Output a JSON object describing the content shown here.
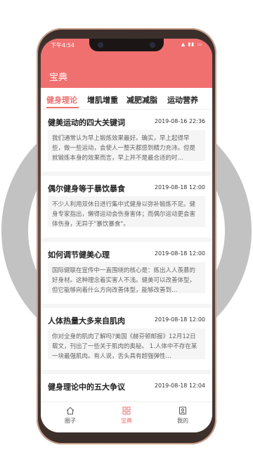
{
  "status_bar": {
    "time": "下午4:54",
    "icons": "▲ ▮▮ ▭"
  },
  "app": {
    "title": "宝典"
  },
  "tabs": [
    {
      "label": "健身理论"
    },
    {
      "label": "增肌增重"
    },
    {
      "label": "减肥减脂"
    },
    {
      "label": "运动营养"
    }
  ],
  "articles": [
    {
      "title": "健美运动的四大关键词",
      "date": "2019-08-16 22:36",
      "summary": "我们通常认为早上锻炼效果最好。确实，早上起得早些，做一些运动，会使人一整天都感到精力充沛。但是就锻炼本身的效果而言，早上并不是最合适的时…"
    },
    {
      "title": "偶尔健身等于暴饮暴食",
      "date": "2019-08-18 12:00",
      "summary": "不少人利用双休日进行集中式健身以弥补锻炼不足。健身专家指出，懒得运动会伤身害体；而偶尔运动更会害体伤身，无异于\"暴饮暴食\"。"
    },
    {
      "title": "如何调节健美心理",
      "date": "2019-08-18 12:00",
      "summary": "国际健联在宣传中一直围绕的核心是：练出人人羡慕的好身材。这种理念着实害人不浅。健美可以改善体型，但它能够向着什么方向改善体型，能够改善到…"
    },
    {
      "title": "人体热量大多来自肌肉",
      "date": "2019-08-18 12:00",
      "summary": "你对全身的肌肉了解吗?美国《赫芬顿邮报》12月12日载文，刊出了一些关于肌肉的奥秘。        1.人体中不存在某一块最强肌肉。有人说，舌头具有超强弹性…"
    },
    {
      "title": "健身理论中的五大争议",
      "date": "2019-08-18 12:04",
      "summary": ""
    }
  ],
  "bottom_nav": [
    {
      "label": "圈子"
    },
    {
      "label": "宝典"
    },
    {
      "label": "我的"
    }
  ],
  "colors": {
    "accent": "#f07070"
  }
}
